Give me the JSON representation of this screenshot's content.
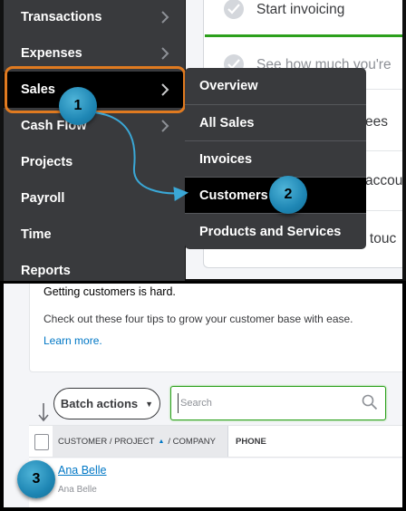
{
  "sidebar": {
    "items": [
      {
        "label": "Transactions",
        "has_chevron": true
      },
      {
        "label": "Expenses",
        "has_chevron": true
      },
      {
        "label": "Sales",
        "has_chevron": true
      },
      {
        "label": "Cash Flow",
        "has_chevron": true
      },
      {
        "label": "Projects",
        "has_chevron": false
      },
      {
        "label": "Payroll",
        "has_chevron": false
      },
      {
        "label": "Time",
        "has_chevron": false
      },
      {
        "label": "Reports",
        "has_chevron": false
      }
    ],
    "active": "Sales"
  },
  "sales_submenu": {
    "items": [
      "Overview",
      "All Sales",
      "Invoices",
      "Customers",
      "Products and Services"
    ],
    "active": "Customers"
  },
  "setup_tasks": [
    "Start invoicing",
    "See how much you're",
    "ees",
    "accou",
    "g touc"
  ],
  "step_badges": [
    "1",
    "2",
    "3"
  ],
  "tips": {
    "title": "Getting customers is hard.",
    "body": "Check out these four tips to grow your customer base with ease.",
    "link": "Learn more."
  },
  "toolbar": {
    "batch_label": "Batch actions",
    "search_placeholder": "Search"
  },
  "table": {
    "columns": [
      "CUSTOMER / PROJECT",
      "/ COMPANY",
      "PHONE"
    ],
    "rows": [
      {
        "name": "Ana Belle",
        "company": "Ana Belle"
      }
    ]
  },
  "colors": {
    "sidebar": "#393a3d",
    "highlight_outline": "#e07a20",
    "badge": "#1e86b4",
    "link": "#0077c5",
    "success_green": "#2ca01c"
  }
}
